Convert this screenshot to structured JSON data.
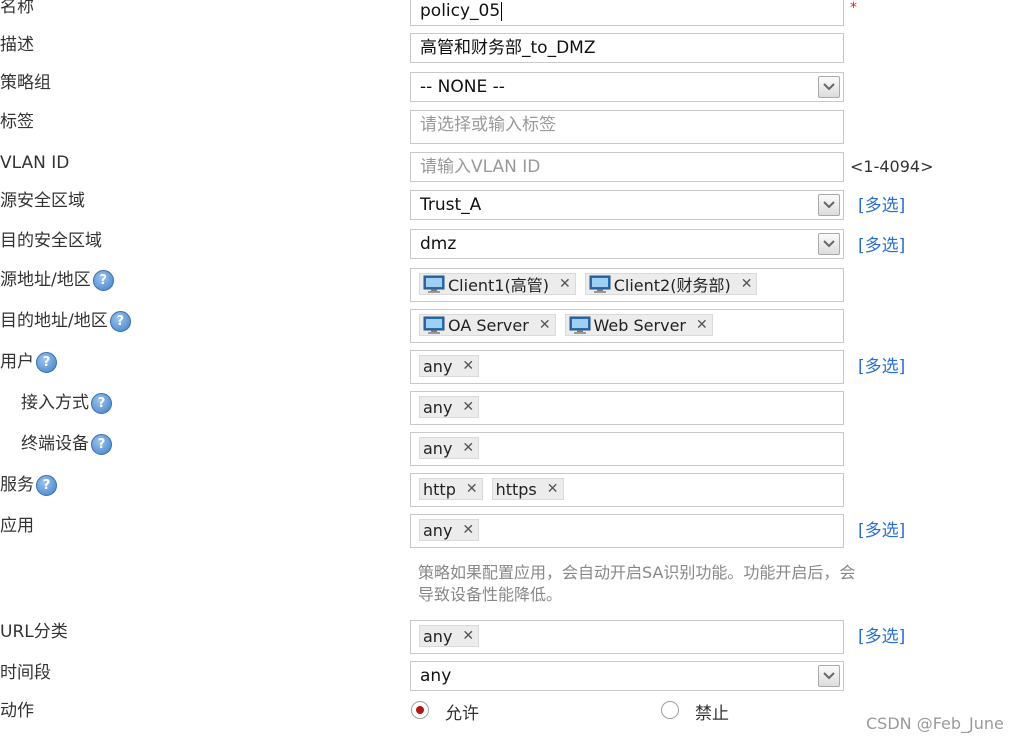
{
  "form": {
    "name": {
      "label": "名称",
      "value": "policy_05",
      "required_mark": "*"
    },
    "description": {
      "label": "描述",
      "value": "高管和财务部_to_DMZ"
    },
    "policy_group": {
      "label": "策略组",
      "value": "-- NONE --"
    },
    "tags": {
      "label": "标签",
      "placeholder": "请选择或输入标签"
    },
    "vlan": {
      "label": "VLAN ID",
      "placeholder": "请输入VLAN ID",
      "range": "<1-4094>"
    },
    "src_zone": {
      "label": "源安全区域",
      "value": "Trust_A",
      "multi": "[多选]"
    },
    "dst_zone": {
      "label": "目的安全区域",
      "value": "dmz",
      "multi": "[多选]"
    },
    "src_addr": {
      "label": "源地址/地区",
      "items": [
        "Client1(高管)",
        "Client2(财务部)"
      ]
    },
    "dst_addr": {
      "label": "目的地址/地区",
      "items": [
        "OA Server",
        "Web Server"
      ]
    },
    "user": {
      "label": "用户",
      "items": [
        "any"
      ],
      "multi": "[多选]"
    },
    "access_method": {
      "label": "接入方式",
      "items": [
        "any"
      ]
    },
    "terminal": {
      "label": "终端设备",
      "items": [
        "any"
      ]
    },
    "service": {
      "label": "服务",
      "items": [
        "http",
        "https"
      ]
    },
    "application": {
      "label": "应用",
      "items": [
        "any"
      ],
      "multi": "[多选]",
      "note": "策略如果配置应用，会自动开启SA识别功能。功能开启后，会导致设备性能降低。"
    },
    "url_category": {
      "label": "URL分类",
      "items": [
        "any"
      ],
      "multi": "[多选]"
    },
    "time_range": {
      "label": "时间段",
      "value": "any"
    },
    "action": {
      "label": "动作",
      "allow": "允许",
      "deny": "禁止",
      "selected": "允许"
    }
  },
  "watermark": "CSDN @Feb_June",
  "help_glyph": "?",
  "remove_glyph": "✕",
  "colors": {
    "link": "#2a6fd0",
    "required": "#e02020",
    "radio_dot": "#b01818"
  }
}
